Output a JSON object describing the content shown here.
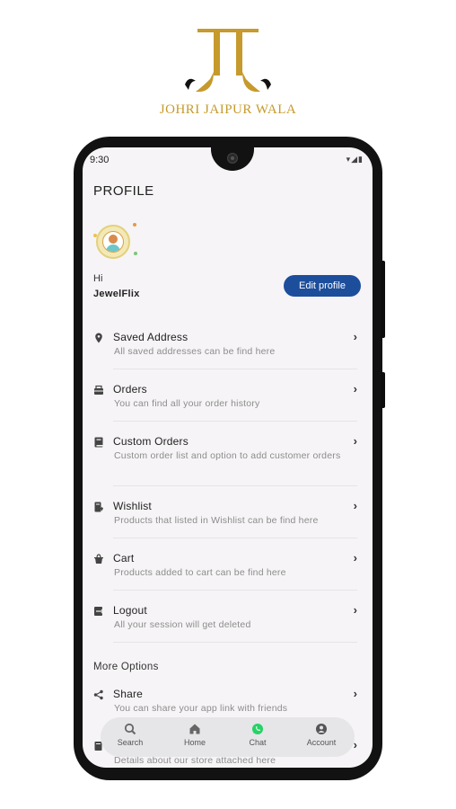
{
  "brand": {
    "name": "JOHRI JAIPUR WALA",
    "color": "#c69a2c"
  },
  "status_bar": {
    "time": "9:30",
    "icons": "▾◢▮"
  },
  "page_title": "PROFILE",
  "profile": {
    "greeting": "Hi",
    "username": "JewelFlix",
    "edit_label": "Edit profile",
    "button_color": "#1c4e9c"
  },
  "menu": [
    {
      "label": "Saved Address",
      "sub": "All saved addresses can be find here",
      "icon": "location-pin-icon"
    },
    {
      "label": "Orders",
      "sub": "You can find all your order history",
      "icon": "orders-icon"
    },
    {
      "label": "Custom Orders",
      "sub": "Custom order list and option to add customer orders",
      "icon": "book-icon"
    },
    {
      "label": "Wishlist",
      "sub": "Products that listed in Wishlist can be find here",
      "icon": "wishlist-icon"
    },
    {
      "label": "Cart",
      "sub": "Products added to cart can be find here",
      "icon": "cart-icon"
    },
    {
      "label": "Logout",
      "sub": "All your session will get deleted",
      "icon": "logout-icon"
    }
  ],
  "more_options": {
    "title": "More Options",
    "items": [
      {
        "label": "Share",
        "sub": "You can share your app link with friends",
        "icon": "share-icon"
      },
      {
        "label": "",
        "sub": "Details about our store attached here",
        "icon": "store-icon"
      }
    ]
  },
  "chevron": "›",
  "bottom_nav": [
    {
      "label": "Search",
      "icon": "search-icon"
    },
    {
      "label": "Home",
      "icon": "home-icon"
    },
    {
      "label": "Chat",
      "icon": "whatsapp-icon",
      "color": "#25d366"
    },
    {
      "label": "Account",
      "icon": "account-icon"
    }
  ]
}
